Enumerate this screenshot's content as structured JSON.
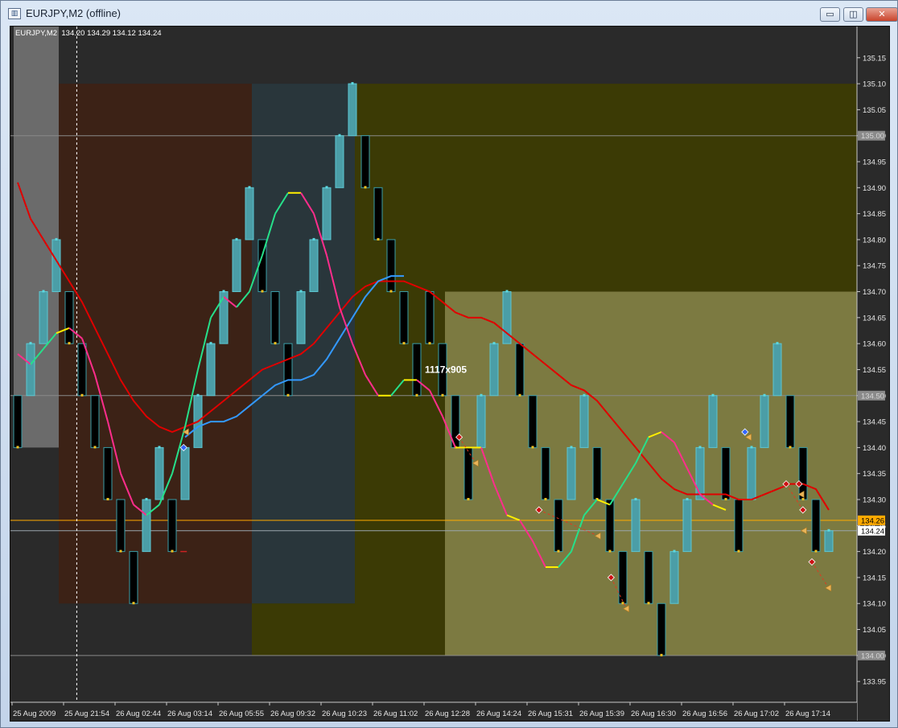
{
  "window": {
    "title": "EURJPY,M2 (offline)",
    "buttons": {
      "minimize": "▭",
      "restore": "◫",
      "close": "✕"
    }
  },
  "chart_header": {
    "symbol": "EURJPY,M2",
    "ohlc": "134.20 134.29 134.12 134.24"
  },
  "overlay_text": "1117x905",
  "colors": {
    "chart_bg": "#2a2a2a",
    "zone_brown": "#3c2216",
    "zone_teal": "#29363b",
    "zone_olive_dark": "#3b3a05",
    "zone_olive_light": "#7c7a41",
    "zone_grey": "#6b6b6b",
    "bull_candle": "#4b9ea7",
    "bear_candle": "#000000",
    "ma_slow": "#e00000",
    "ma_mid": "#3399ff",
    "ma_fast": "#26e08a",
    "ma_fast_down": "#ff2d8c",
    "flat_segment": "#ffee00",
    "price_line": "#ffaa00"
  },
  "chart_data": {
    "type": "candlestick",
    "symbol": "EURJPY",
    "timeframe": "M2",
    "ylim": [
      133.91,
      135.21
    ],
    "price_axis_ticks": [
      "135.15",
      "135.10",
      "135.05",
      "135.00",
      "134.95",
      "134.90",
      "134.85",
      "134.80",
      "134.75",
      "134.70",
      "134.65",
      "134.60",
      "134.55",
      "134.50",
      "134.45",
      "134.40",
      "134.35",
      "134.30",
      "134.25",
      "134.20",
      "134.15",
      "134.10",
      "134.05",
      "134.00",
      "133.95"
    ],
    "time_axis_ticks": [
      "25 Aug 2009",
      "25 Aug 21:54",
      "26 Aug 02:44",
      "26 Aug 03:14",
      "26 Aug 05:55",
      "26 Aug 09:32",
      "26 Aug 10:23",
      "26 Aug 11:02",
      "26 Aug 12:28",
      "26 Aug 14:24",
      "26 Aug 15:31",
      "26 Aug 15:39",
      "26 Aug 16:30",
      "26 Aug 16:56",
      "26 Aug 17:02",
      "26 Aug 17:14"
    ],
    "horizontal_levels": [
      {
        "price": 135.0,
        "label": "135.00",
        "style": "grey"
      },
      {
        "price": 134.5,
        "label": "134.50",
        "style": "grey"
      },
      {
        "price": 134.26,
        "label": "134.26",
        "style": "orange"
      },
      {
        "price": 134.24,
        "label": "134.24",
        "style": "current"
      },
      {
        "price": 134.0,
        "label": "134.00",
        "style": "grey"
      }
    ],
    "zones": [
      {
        "from": 0,
        "to": 3.5,
        "top": 135.21,
        "bottom": 134.4,
        "color": "zone_grey"
      },
      {
        "from": 3.5,
        "to": 18.5,
        "top": 135.1,
        "bottom": 134.1,
        "color": "zone_brown"
      },
      {
        "from": 18.5,
        "to": 26.5,
        "top": 135.1,
        "bottom": 134.1,
        "color": "zone_teal"
      },
      {
        "from": 18.5,
        "to": 26.5,
        "top": 134.1,
        "bottom": 134.0,
        "color": "zone_olive_dark"
      },
      {
        "from": 26.5,
        "to": 33.5,
        "top": 135.1,
        "bottom": 134.0,
        "color": "zone_olive_dark"
      },
      {
        "from": 33.5,
        "to": 66,
        "top": 135.1,
        "bottom": 134.7,
        "color": "zone_olive_dark"
      },
      {
        "from": 33.5,
        "to": 66,
        "top": 134.7,
        "bottom": 134.0,
        "color": "zone_olive_light"
      }
    ],
    "candles": [
      {
        "o": 134.5,
        "c": 134.4
      },
      {
        "o": 134.5,
        "c": 134.6
      },
      {
        "o": 134.6,
        "c": 134.7
      },
      {
        "o": 134.7,
        "c": 134.8
      },
      {
        "o": 134.7,
        "c": 134.6
      },
      {
        "o": 134.6,
        "c": 134.5
      },
      {
        "o": 134.5,
        "c": 134.4
      },
      {
        "o": 134.4,
        "c": 134.3
      },
      {
        "o": 134.3,
        "c": 134.2
      },
      {
        "o": 134.2,
        "c": 134.1
      },
      {
        "o": 134.2,
        "c": 134.3
      },
      {
        "o": 134.3,
        "c": 134.4
      },
      {
        "o": 134.3,
        "c": 134.2
      },
      {
        "o": 134.3,
        "c": 134.4
      },
      {
        "o": 134.4,
        "c": 134.5
      },
      {
        "o": 134.5,
        "c": 134.6
      },
      {
        "o": 134.6,
        "c": 134.7
      },
      {
        "o": 134.7,
        "c": 134.8
      },
      {
        "o": 134.8,
        "c": 134.9
      },
      {
        "o": 134.8,
        "c": 134.7
      },
      {
        "o": 134.7,
        "c": 134.6
      },
      {
        "o": 134.6,
        "c": 134.5
      },
      {
        "o": 134.6,
        "c": 134.7
      },
      {
        "o": 134.7,
        "c": 134.8
      },
      {
        "o": 134.8,
        "c": 134.9
      },
      {
        "o": 134.9,
        "c": 135.0
      },
      {
        "o": 135.0,
        "c": 135.1
      },
      {
        "o": 135.0,
        "c": 134.9
      },
      {
        "o": 134.9,
        "c": 134.8
      },
      {
        "o": 134.8,
        "c": 134.7
      },
      {
        "o": 134.7,
        "c": 134.6
      },
      {
        "o": 134.6,
        "c": 134.5
      },
      {
        "o": 134.7,
        "c": 134.6
      },
      {
        "o": 134.6,
        "c": 134.5
      },
      {
        "o": 134.5,
        "c": 134.4
      },
      {
        "o": 134.4,
        "c": 134.3
      },
      {
        "o": 134.4,
        "c": 134.5
      },
      {
        "o": 134.5,
        "c": 134.6
      },
      {
        "o": 134.6,
        "c": 134.7
      },
      {
        "o": 134.6,
        "c": 134.5
      },
      {
        "o": 134.5,
        "c": 134.4
      },
      {
        "o": 134.4,
        "c": 134.3
      },
      {
        "o": 134.3,
        "c": 134.2
      },
      {
        "o": 134.3,
        "c": 134.4
      },
      {
        "o": 134.4,
        "c": 134.5
      },
      {
        "o": 134.4,
        "c": 134.3
      },
      {
        "o": 134.3,
        "c": 134.2
      },
      {
        "o": 134.2,
        "c": 134.1
      },
      {
        "o": 134.2,
        "c": 134.3
      },
      {
        "o": 134.2,
        "c": 134.1
      },
      {
        "o": 134.1,
        "c": 134.0
      },
      {
        "o": 134.1,
        "c": 134.2
      },
      {
        "o": 134.2,
        "c": 134.3
      },
      {
        "o": 134.3,
        "c": 134.4
      },
      {
        "o": 134.4,
        "c": 134.5
      },
      {
        "o": 134.4,
        "c": 134.3
      },
      {
        "o": 134.3,
        "c": 134.2
      },
      {
        "o": 134.3,
        "c": 134.4
      },
      {
        "o": 134.4,
        "c": 134.5
      },
      {
        "o": 134.5,
        "c": 134.6
      },
      {
        "o": 134.5,
        "c": 134.4
      },
      {
        "o": 134.4,
        "c": 134.3
      },
      {
        "o": 134.3,
        "c": 134.2
      },
      {
        "o": 134.2,
        "c": 134.24
      }
    ],
    "series": [
      {
        "color": "ma_slow",
        "values": [
          134.91,
          134.84,
          134.8,
          134.76,
          134.72,
          134.68,
          134.63,
          134.58,
          134.53,
          134.49,
          134.46,
          134.44,
          134.43,
          134.44,
          134.45,
          134.47,
          134.49,
          134.51,
          134.53,
          134.55,
          134.56,
          134.57,
          134.58,
          134.6,
          134.63,
          134.66,
          134.69,
          134.71,
          134.72,
          134.72,
          134.72,
          134.71,
          134.7,
          134.68,
          134.66,
          134.65,
          134.65,
          134.64,
          134.62,
          134.6,
          134.58,
          134.56,
          134.54,
          134.52,
          134.51,
          134.49,
          134.46,
          134.43,
          134.4,
          134.37,
          134.34,
          134.32,
          134.31,
          134.31,
          134.31,
          134.31,
          134.3,
          134.3,
          134.31,
          134.32,
          134.33,
          134.33,
          134.32,
          134.28
        ]
      },
      {
        "color": "ma_mid",
        "values": [
          null,
          null,
          null,
          null,
          null,
          null,
          null,
          null,
          null,
          null,
          null,
          null,
          null,
          134.42,
          134.44,
          134.45,
          134.45,
          134.46,
          134.48,
          134.5,
          134.52,
          134.53,
          134.53,
          134.54,
          134.57,
          134.61,
          134.65,
          134.69,
          134.72,
          134.73,
          134.73
        ]
      },
      {
        "color": "ma_fast",
        "values": [
          134.58,
          134.56,
          134.59,
          134.62,
          134.63,
          134.61,
          134.54,
          134.45,
          134.35,
          134.29,
          134.27,
          134.29,
          134.35,
          134.44,
          134.55,
          134.65,
          134.69,
          134.67,
          134.7,
          134.77,
          134.85,
          134.89,
          134.89,
          134.85,
          134.77,
          134.67,
          134.6,
          134.54,
          134.5,
          134.5,
          134.53,
          134.53,
          134.51,
          134.46,
          134.4,
          134.4,
          134.4,
          134.33,
          134.27,
          134.26,
          134.22,
          134.17,
          134.17,
          134.2,
          134.27,
          134.3,
          134.29,
          134.33,
          134.37,
          134.42,
          134.43,
          134.41,
          134.36,
          134.31,
          134.29,
          134.28
        ]
      }
    ],
    "markers": [
      {
        "x": 13.2,
        "price": 134.4,
        "shape": "diamond",
        "color": "#3366ff"
      },
      {
        "x": 13.4,
        "price": 134.43,
        "shape": "triangle",
        "color": "#e8b458"
      },
      {
        "x": 13.2,
        "price": 134.2,
        "shape": "dash",
        "color": "#cc2222"
      },
      {
        "x": 34.6,
        "price": 134.42,
        "shape": "diamond",
        "color": "#cc1111"
      },
      {
        "x": 35.9,
        "price": 134.37,
        "shape": "triangle",
        "color": "#e8b458"
      },
      {
        "x": 40.8,
        "price": 134.28,
        "shape": "diamond",
        "color": "#cc1111"
      },
      {
        "x": 45.4,
        "price": 134.23,
        "shape": "triangle",
        "color": "#e8b458"
      },
      {
        "x": 46.4,
        "price": 134.15,
        "shape": "diamond",
        "color": "#cc1111"
      },
      {
        "x": 47.6,
        "price": 134.09,
        "shape": "triangle",
        "color": "#e8b458"
      },
      {
        "x": 56.8,
        "price": 134.43,
        "shape": "diamond",
        "color": "#3366ff"
      },
      {
        "x": 57.1,
        "price": 134.42,
        "shape": "triangle",
        "color": "#e8b458"
      },
      {
        "x": 60.0,
        "price": 134.33,
        "shape": "diamond",
        "color": "#cc1111"
      },
      {
        "x": 61.0,
        "price": 134.33,
        "shape": "diamond",
        "color": "#cc1111"
      },
      {
        "x": 61.2,
        "price": 134.31,
        "shape": "triangle",
        "color": "#e8b458"
      },
      {
        "x": 61.3,
        "price": 134.28,
        "shape": "diamond",
        "color": "#cc1111"
      },
      {
        "x": 61.4,
        "price": 134.24,
        "shape": "triangle",
        "color": "#e8b458"
      },
      {
        "x": 62.0,
        "price": 134.18,
        "shape": "diamond",
        "color": "#cc1111"
      },
      {
        "x": 63.3,
        "price": 134.13,
        "shape": "triangle",
        "color": "#e8b458"
      }
    ],
    "dashed_links": [
      [
        34.6,
        134.42,
        35.9,
        134.37
      ],
      [
        40.8,
        134.28,
        45.4,
        134.23
      ],
      [
        46.4,
        134.15,
        47.6,
        134.09
      ],
      [
        60.0,
        134.33,
        61.3,
        134.28
      ],
      [
        62.0,
        134.18,
        63.3,
        134.13
      ]
    ],
    "vertical_cursor_x": 4.9,
    "grid": false
  }
}
